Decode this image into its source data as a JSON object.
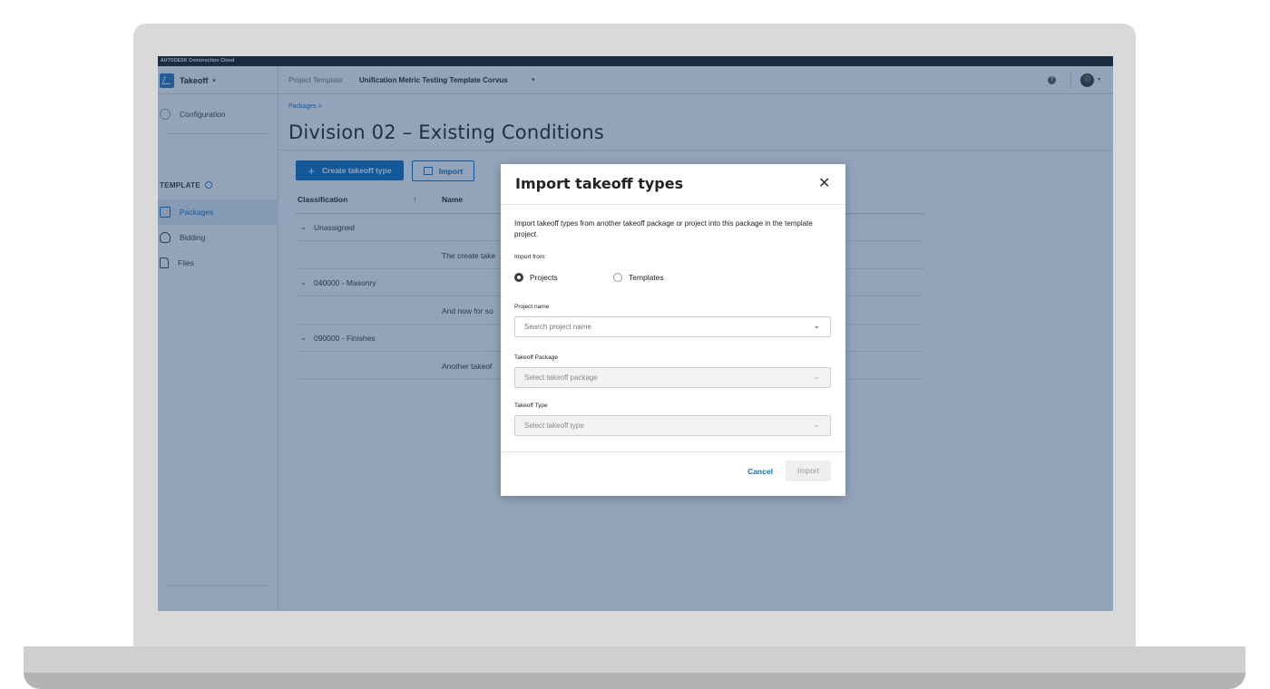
{
  "brand": "AUTODESK Construction Cloud",
  "topbar": {
    "app_name": "Takeoff",
    "project_label": "Project Template",
    "project_name": "Unification Metric Testing Template Corvus"
  },
  "sidebar": {
    "configuration": "Configuration",
    "section_title": "TEMPLATE",
    "items": [
      {
        "label": "Packages",
        "icon": "package-icon",
        "active": true
      },
      {
        "label": "Bidding",
        "icon": "trophy-icon",
        "active": false
      },
      {
        "label": "Files",
        "icon": "file-icon",
        "active": false
      }
    ],
    "collapse_glyph": "|←"
  },
  "main": {
    "breadcrumb": "Packages >",
    "title": "Division 02 – Existing Conditions",
    "create_button": "Create takeoff type",
    "import_button": "Import",
    "table": {
      "columns": [
        "Classification",
        "Name"
      ],
      "sort_glyph": "↑",
      "groups": [
        {
          "classification": "Unassigned",
          "name": "The create take"
        },
        {
          "classification": "040000 - Masonry",
          "name": "And now for so"
        },
        {
          "classification": "090000 - Finishes",
          "name": "Another takeof"
        }
      ]
    }
  },
  "modal": {
    "title": "Import takeoff types",
    "description": "Import takeoff types from another takeoff package or project into this package in the template project.",
    "import_from_label": "Import from:",
    "options": [
      {
        "label": "Projects",
        "checked": true
      },
      {
        "label": "Templates",
        "checked": false
      }
    ],
    "project_name_label": "Project name",
    "project_name_placeholder": "Search project name",
    "takeoff_package_label": "Takeoff Package",
    "takeoff_package_placeholder": "Select takeoff package",
    "takeoff_type_label": "Takeoff Type",
    "takeoff_type_placeholder": "Select takeoff type",
    "cancel_label": "Cancel",
    "import_label": "Import"
  },
  "colors": {
    "accent": "#0b6fbf",
    "overlay": "#1e3e6e",
    "frame": "#d9d9d9"
  }
}
